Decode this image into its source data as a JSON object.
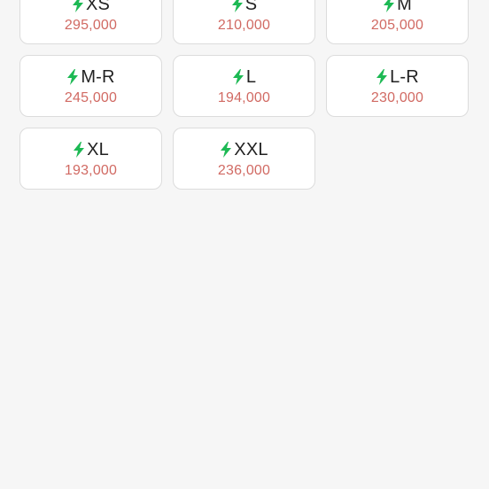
{
  "colors": {
    "background": "#f6f6f6",
    "card": "#ffffff",
    "bolt": "#1db954",
    "price": "#d16a63",
    "size_text": "#222222"
  },
  "icon": "lightning-bolt-icon",
  "sizes": [
    {
      "label": "XS",
      "price": "295,000"
    },
    {
      "label": "S",
      "price": "210,000"
    },
    {
      "label": "M",
      "price": "205,000"
    },
    {
      "label": "M-R",
      "price": "245,000"
    },
    {
      "label": "L",
      "price": "194,000"
    },
    {
      "label": "L-R",
      "price": "230,000"
    },
    {
      "label": "XL",
      "price": "193,000"
    },
    {
      "label": "XXL",
      "price": "236,000"
    }
  ]
}
